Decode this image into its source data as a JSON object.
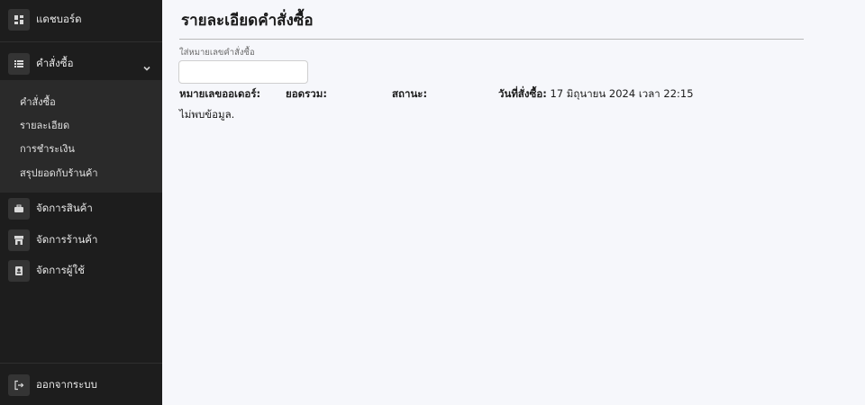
{
  "sidebar": {
    "dashboard": {
      "label": "แดชบอร์ด",
      "icon": "dashboard-icon"
    },
    "orders": {
      "label": "คำสั่งซื้อ",
      "icon": "list-icon",
      "expanded": true,
      "items": [
        {
          "label": "คำสั่งซื้อ"
        },
        {
          "label": "รายละเอียด"
        },
        {
          "label": "การชำระเงิน"
        },
        {
          "label": "สรุปยอดกับร้านค้า"
        }
      ]
    },
    "products": {
      "label": "จัดการสินค้า",
      "icon": "briefcase-icon"
    },
    "stores": {
      "label": "จัดการร้านค้า",
      "icon": "store-icon"
    },
    "users": {
      "label": "จัดการผู้ใช้",
      "icon": "user-badge-icon"
    },
    "logout": {
      "label": "ออกจากระบบ",
      "icon": "logout-icon"
    }
  },
  "main": {
    "title": "รายละเอียดคำสั่งซื้อ",
    "search": {
      "label": "ใส่หมายเลขคำสั่งซื้อ",
      "value": "",
      "placeholder": ""
    },
    "info": {
      "order_no_label": "หมายเลขออเดอร์:",
      "total_label": "ยอดรวม:",
      "status_label": "สถานะ:",
      "date_label": "วันที่สั่งซื้อ:",
      "date_value": " 17 มิถุนายน 2024 เวลา 22:15"
    },
    "empty_message": "ไม่พบข้อมูล."
  }
}
